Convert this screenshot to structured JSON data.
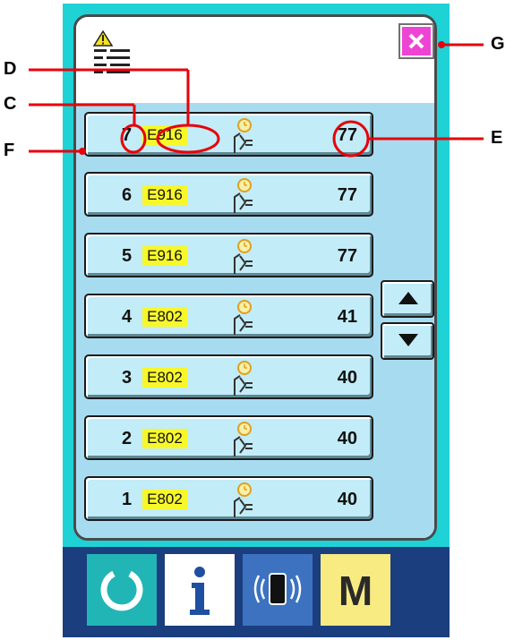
{
  "header": {
    "history_icon": "warning-list-icon",
    "close_icon": "close-icon"
  },
  "rows": [
    {
      "number": "7",
      "code": "E916",
      "count": "77",
      "icon": "clock-connector-icon"
    },
    {
      "number": "6",
      "code": "E916",
      "count": "77",
      "icon": "clock-connector-icon"
    },
    {
      "number": "5",
      "code": "E916",
      "count": "77",
      "icon": "clock-connector-icon"
    },
    {
      "number": "4",
      "code": "E802",
      "count": "41",
      "icon": "clock-connector-icon"
    },
    {
      "number": "3",
      "code": "E802",
      "count": "40",
      "icon": "clock-connector-icon"
    },
    {
      "number": "2",
      "code": "E802",
      "count": "40",
      "icon": "clock-connector-icon"
    },
    {
      "number": "1",
      "code": "E802",
      "count": "40",
      "icon": "clock-connector-icon"
    }
  ],
  "scroll": {
    "up_icon": "arrow-up-icon",
    "down_icon": "arrow-down-icon"
  },
  "bottom_bar": {
    "reset_icon": "reset-icon",
    "info_icon": "info-icon",
    "communication_icon": "communication-icon",
    "mode_label": "M"
  },
  "callouts": {
    "c": "C",
    "d": "D",
    "e": "E",
    "f": "F",
    "g": "G"
  },
  "colors": {
    "panel": "#1fd2d6",
    "list_background": "#a7dcf0",
    "row_button": "#c2ecf7",
    "code_highlight": "#f7f72a",
    "close_button": "#ee44d4",
    "bottom_bar": "#1a3e7e",
    "annotation": "#e8000a"
  }
}
